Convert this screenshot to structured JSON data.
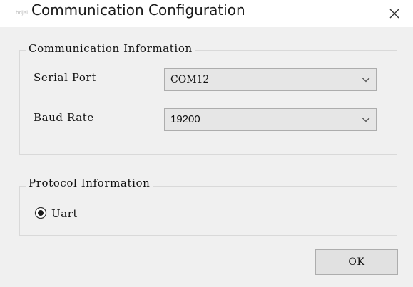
{
  "window": {
    "title": "Communication Configuration",
    "app_icon_text": "bdjai"
  },
  "icons": {
    "close": "close-icon",
    "dropdown": "chevron-down-icon",
    "radio": "radio-selected-icon"
  },
  "communication_group": {
    "label": "Communication Information",
    "serial_port": {
      "label": "Serial Port",
      "value": "COM12"
    },
    "baud_rate": {
      "label": "Baud Rate",
      "value": "19200"
    }
  },
  "protocol_group": {
    "label": "Protocol Information",
    "options": [
      {
        "label": "Uart",
        "selected": true
      }
    ]
  },
  "footer": {
    "ok_label": "OK"
  },
  "colors": {
    "dialog_bg": "#f0f0f0",
    "titlebar_bg": "#ffffff",
    "combo_bg": "#e6e6e6",
    "border": "#adadad"
  }
}
